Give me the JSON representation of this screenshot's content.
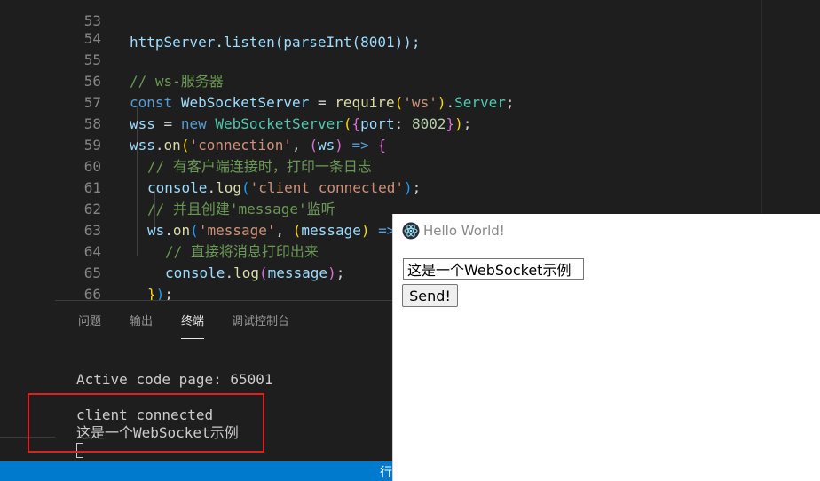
{
  "editor": {
    "partial_top_line": "httpServer.listen(parseInt(8001));",
    "partial_top_number": "53",
    "lines": [
      {
        "n": "54"
      },
      {
        "n": "55",
        "comment": "// ws-服务器"
      },
      {
        "n": "56",
        "kw": "const",
        "name": "WebSocketServer",
        "eq": " = ",
        "fn": "require",
        "p1": "(",
        "str": "'ws'",
        "p2": ")",
        "dot": ".",
        "cls": "Server",
        "semi": ";"
      },
      {
        "n": "57",
        "name": "wss",
        "eq": " = ",
        "kw": "new",
        "cls": "WebSocketServer",
        "p1": "(",
        "b1": "{",
        "key": "port",
        "colon": ": ",
        "num": "8002",
        "b2": "}",
        "p2": ")",
        "semi": ";"
      },
      {
        "n": "58",
        "name": "wss",
        "dot": ".",
        "fn": "on",
        "p1": "(",
        "str": "'connection'",
        "comma": ", ",
        "p3": "(",
        "param": "ws",
        "p4": ")",
        "arrow": " => ",
        "b1": "{"
      },
      {
        "n": "59",
        "comment": "// 有客户端连接时，打印一条日志"
      },
      {
        "n": "60",
        "name": "console",
        "dot": ".",
        "fn": "log",
        "p1": "(",
        "str": "'client connected'",
        "p2": ")",
        "semi": ";"
      },
      {
        "n": "61",
        "comment": "// 并且创建'message'监听"
      },
      {
        "n": "62",
        "name": "ws",
        "dot": ".",
        "fn": "on",
        "p1": "(",
        "str": "'message'",
        "comma": ", ",
        "p3": "(",
        "param": "message",
        "p4": ")",
        "arrow": " => ",
        "b1": "{"
      },
      {
        "n": "63",
        "comment": "// 直接将消息打印出来"
      },
      {
        "n": "64",
        "name": "console",
        "dot": ".",
        "fn": "log",
        "p1": "(",
        "param": "message",
        "p2": ")",
        "semi": ";"
      },
      {
        "n": "65",
        "b2": "}",
        "p2": ")",
        "semi": ";"
      },
      {
        "n": "66",
        "b2": "}",
        "p2": ")",
        "semi": ";"
      }
    ]
  },
  "panel": {
    "tabs": [
      {
        "label": "问题"
      },
      {
        "label": "输出"
      },
      {
        "label": "终端",
        "active": true
      },
      {
        "label": "调试控制台"
      }
    ],
    "terminal": {
      "line1": "Active code page: 65001",
      "line2": "client connected",
      "line3": "这是一个WebSocket示例"
    }
  },
  "statusbar": {
    "text": "行"
  },
  "app_window": {
    "title": "Hello World!",
    "icon": "electron-icon",
    "input_value": "这是一个WebSocket示例",
    "send_label": "Send!"
  },
  "colors": {
    "editor_bg": "#1e1e1e",
    "statusbar": "#007acc",
    "highlight": "#e02020"
  }
}
